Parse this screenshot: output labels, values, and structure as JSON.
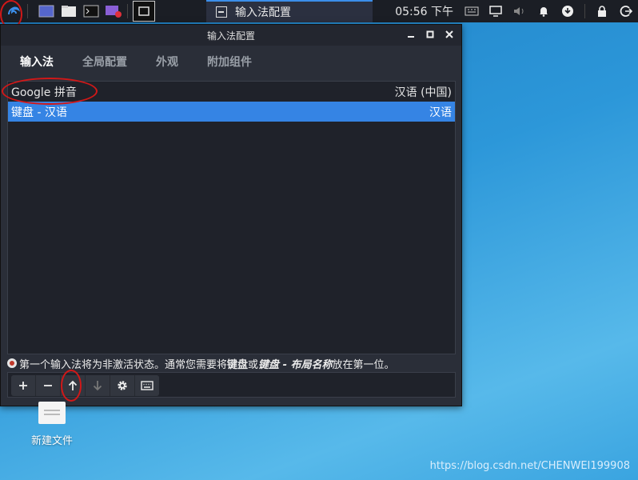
{
  "taskbar": {
    "task_title": "输入法配置",
    "clock": "05:56 下午"
  },
  "window": {
    "title": "输入法配置",
    "tabs": [
      {
        "label": "输入法",
        "active": true
      },
      {
        "label": "全局配置",
        "active": false
      },
      {
        "label": "外观",
        "active": false
      },
      {
        "label": "附加组件",
        "active": false
      }
    ],
    "input_methods": [
      {
        "name": "Google 拼音",
        "language": "汉语 (中国)",
        "selected": false
      },
      {
        "name": "键盘 - 汉语",
        "language": "汉语",
        "selected": true
      }
    ],
    "hint": {
      "part1": "第一个输入法将为非激活状态。通常您需要将",
      "keyboard": "键盘",
      "or": "或",
      "keyboard_layout": "键盘 - 布局名称",
      "part2": "放在第一位。"
    }
  },
  "desktop": {
    "icon_label": "新建文件"
  },
  "watermark": "https://blog.csdn.net/CHENWEI199908",
  "colors": {
    "selection": "#3584e4",
    "annotation": "#d11818"
  }
}
